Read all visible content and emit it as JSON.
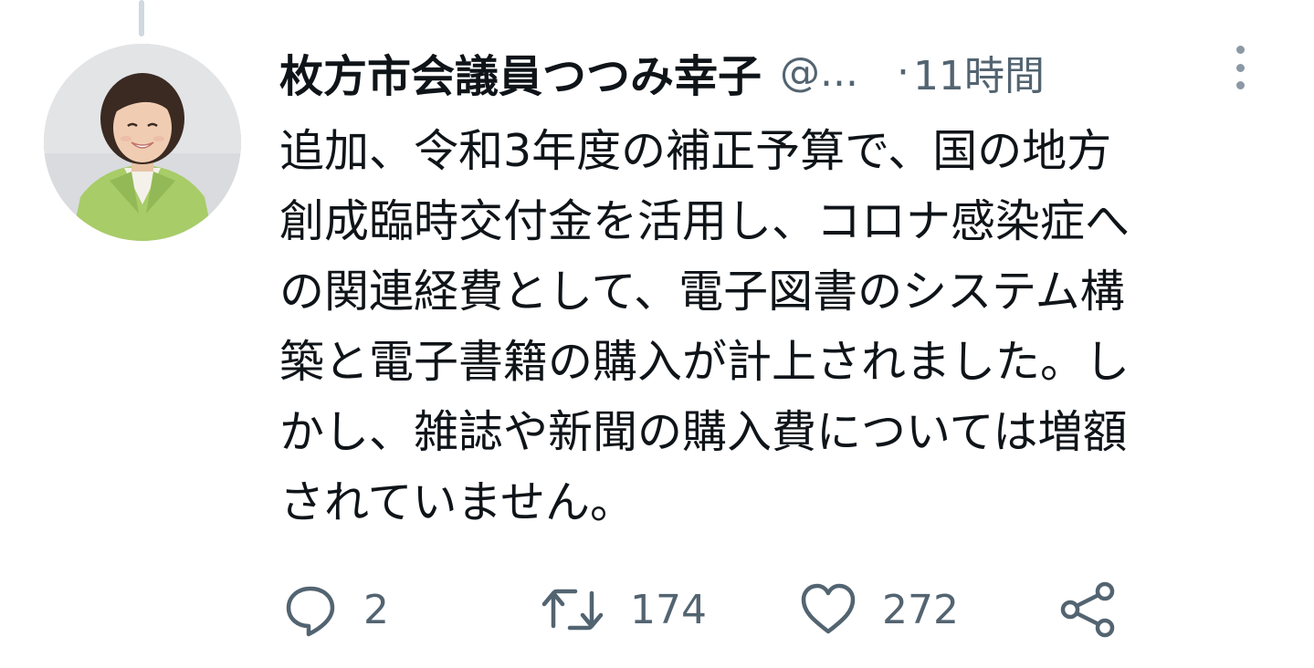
{
  "tweet": {
    "display_name": "枚方市会議員つつみ幸子",
    "handle": "@...",
    "separator": "·",
    "timestamp": "11時間",
    "text_lines": [
      "追加、令和3年度の補正予算で、国の地方",
      "創成臨時交付金を活用し、コロナ感染症へ",
      "の関連経費として、電子図書のシステム構",
      "築と電子書籍の購入が計上されました。し",
      "かし、雑誌や新聞の購入費については増額",
      "されていません。"
    ],
    "reply_count": "2",
    "retweet_count": "174",
    "like_count": "272"
  },
  "icons": {
    "more": "more-vertical-icon",
    "reply": "reply-icon",
    "retweet": "retweet-icon",
    "like": "heart-icon",
    "share": "share-icon"
  },
  "colors": {
    "text": "#0f1419",
    "secondary": "#536471",
    "thread_line": "#cfd9de",
    "avatar_jacket": "#a8cc68"
  }
}
